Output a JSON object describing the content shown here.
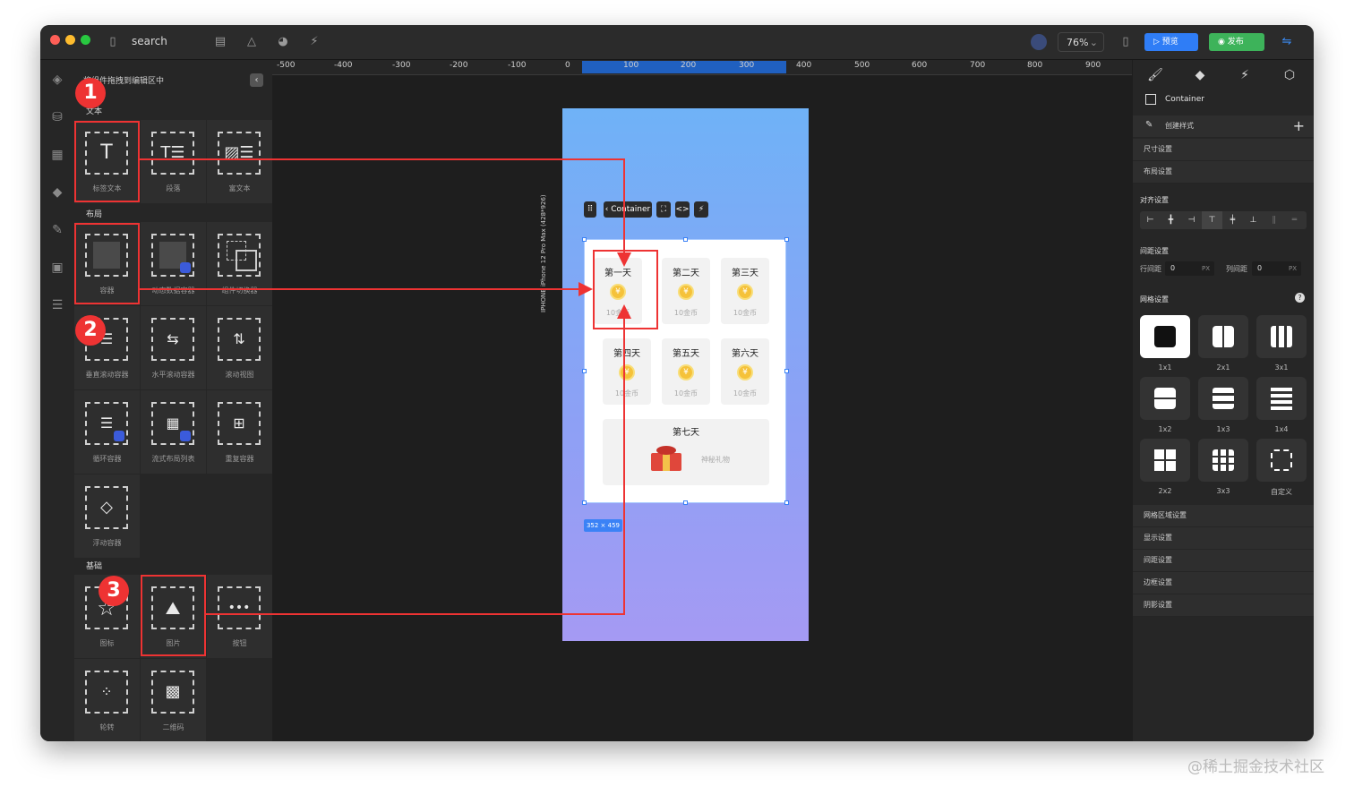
{
  "titlebar": {
    "title": "search",
    "zoom": "76%",
    "preview_label": "预览",
    "publish_label": "发布"
  },
  "left_panel": {
    "hint": "将组件拖拽到编辑区中",
    "sections": {
      "text": "文本",
      "layout": "布局",
      "basic": "基础"
    },
    "text_items": [
      "标签文本",
      "段落",
      "富文本"
    ],
    "layout_items": [
      "容器",
      "动态数据容器",
      "组件切换器",
      "垂直滚动容器",
      "水平滚动容器",
      "滚动视图",
      "循环容器",
      "流式布局列表",
      "重复容器",
      "浮动容器"
    ],
    "basic_items": [
      "图标",
      "图片",
      "按钮",
      "轮转",
      "二维码"
    ]
  },
  "ruler": {
    "labels": [
      "-500",
      "-400",
      "-300",
      "-200",
      "-100",
      "0",
      "100",
      "200",
      "300",
      "400",
      "500",
      "600",
      "700",
      "800",
      "900"
    ]
  },
  "canvas": {
    "device_label": "IPHONE  iPhone 12 Pro Max (428*926)",
    "toolbar_label": "Container",
    "size_tag": "352 × 459",
    "days": [
      {
        "name": "第一天",
        "value": "10金币"
      },
      {
        "name": "第二天",
        "value": "10金币"
      },
      {
        "name": "第三天",
        "value": "10金币"
      },
      {
        "name": "第四天",
        "value": "10金币"
      },
      {
        "name": "第五天",
        "value": "10金币"
      },
      {
        "name": "第六天",
        "value": "10金币"
      }
    ],
    "day7": {
      "name": "第七天",
      "gift": "神秘礼物"
    },
    "coin_symbol": "¥"
  },
  "props": {
    "component": "Container",
    "create_style": "创建样式",
    "rows_top": [
      "尺寸设置",
      "布局设置"
    ],
    "align_title": "对齐设置",
    "spacing_title": "间距设置",
    "row_gap_label": "行间距",
    "col_gap_label": "列间距",
    "row_gap_value": "0",
    "col_gap_value": "0",
    "unit": "PX",
    "grid_title": "网格设置",
    "grid_options": [
      "1x1",
      "2x1",
      "3x1",
      "1x2",
      "1x3",
      "1x4",
      "2x2",
      "3x3",
      "自定义"
    ],
    "rows_bottom": [
      "网格区域设置",
      "显示设置",
      "间距设置",
      "边框设置",
      "阴影设置"
    ]
  },
  "annotations": {
    "badges": [
      "1",
      "2",
      "3"
    ],
    "accent": "#e33333"
  },
  "watermark": "@稀土掘金技术社区"
}
